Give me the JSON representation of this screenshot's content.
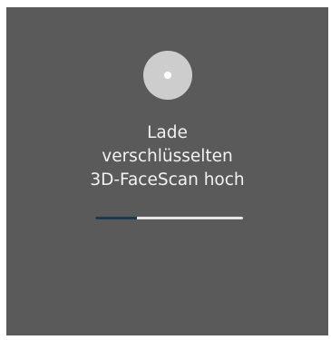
{
  "status": {
    "lines": [
      "Lade",
      "verschlüsselten",
      "3D-FaceScan hoch"
    ]
  },
  "progress": {
    "fraction": 0.28
  },
  "colors": {
    "panel": "#5a5a5a",
    "spinner": "#cdcdcd",
    "progress_track": "#e6e6e6",
    "progress_fill": "#1a3a52",
    "text": "#f2f2f2"
  },
  "icons": {
    "spinner": "loading-spinner-icon"
  }
}
